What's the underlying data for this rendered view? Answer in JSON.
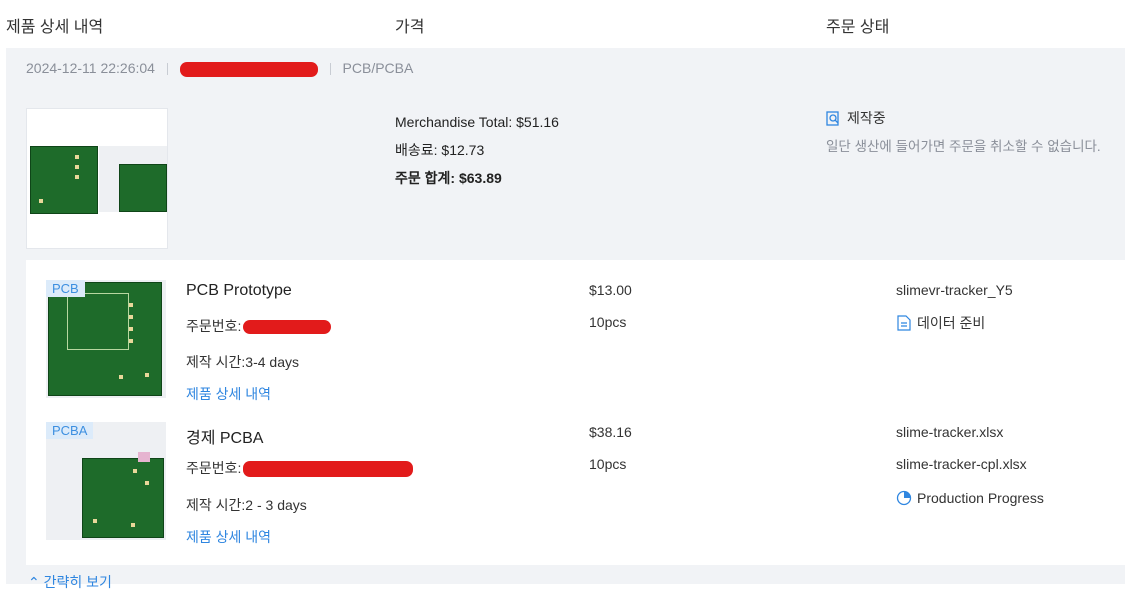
{
  "header": {
    "col_details": "제품 상세 내역",
    "col_price": "가격",
    "col_status": "주문 상태"
  },
  "order": {
    "datetime": "2024-12-11 22:26:04",
    "category": "PCB/PCBA",
    "merchandise_total": "Merchandise Total: $51.16",
    "shipping": "배송료: $12.73",
    "order_total": "주문 합계: $63.89",
    "status_label": "제작중",
    "status_note": "일단 생산에 들어가면 주문을 취소할 수 없습니다."
  },
  "items": [
    {
      "tag": "PCB",
      "name": "PCB Prototype",
      "order_no_label": "주문번호:",
      "build_time": "제작 시간:3-4 days",
      "details_link": "제품 상세 내역",
      "price": "$13.00",
      "qty": "10pcs",
      "file": "slimevr-tracker_Y5",
      "status": "데이터 준비"
    },
    {
      "tag": "PCBA",
      "name": "경제 PCBA",
      "order_no_label": "주문번호:",
      "build_time": "제작 시간:2 - 3 days",
      "details_link": "제품 상세 내역",
      "price": "$38.16",
      "qty": "10pcs",
      "file1": "slime-tracker.xlsx",
      "file2": "slime-tracker-cpl.xlsx",
      "status": "Production Progress"
    }
  ],
  "collapse_label": "간략히 보기",
  "colors": {
    "accent": "#2f86e0",
    "redaction": "#e21b1b",
    "pcb_green": "#1e6b2a"
  },
  "icons": [
    "search-doc-icon",
    "data-file-icon",
    "progress-clock-icon",
    "chevron-up-icon"
  ]
}
